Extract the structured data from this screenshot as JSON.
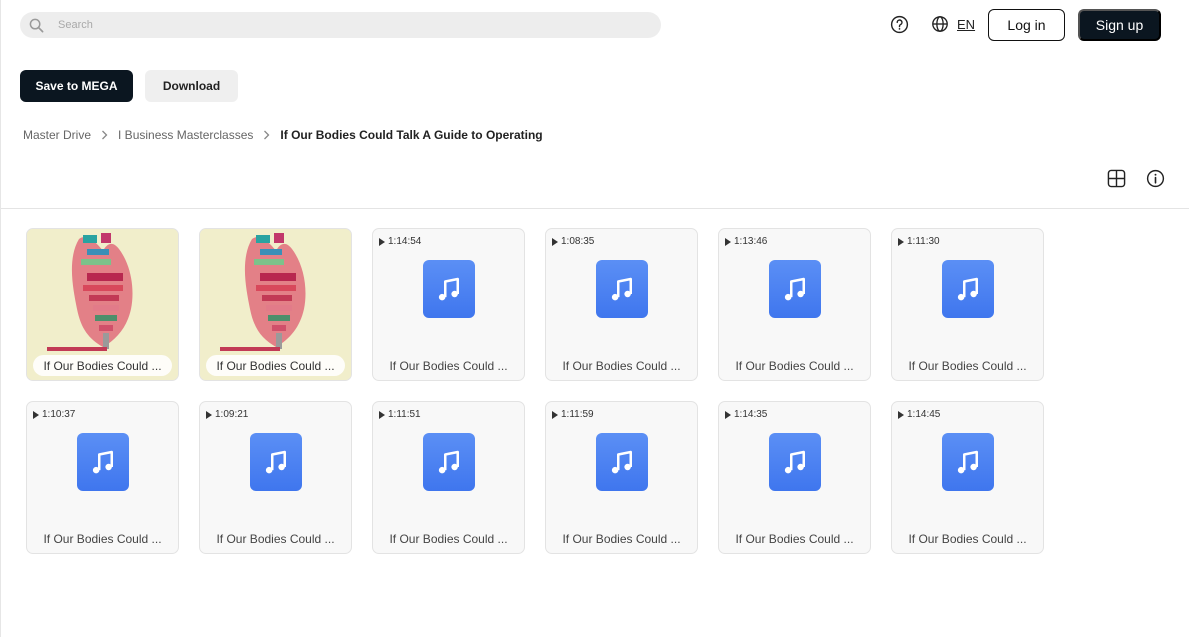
{
  "header": {
    "search_placeholder": "Search",
    "language": "EN",
    "login_label": "Log in",
    "signup_label": "Sign up"
  },
  "actions": {
    "save_label": "Save to MEGA",
    "download_label": "Download"
  },
  "breadcrumb": [
    "Master Drive",
    "I Business Masterclasses",
    "If Our Bodies Could Talk A Guide to Operating"
  ],
  "files": [
    {
      "name": "If Our Bodies Could ...",
      "type": "image",
      "duration": ""
    },
    {
      "name": "If Our Bodies Could ...",
      "type": "image",
      "duration": ""
    },
    {
      "name": "If Our Bodies Could ...",
      "type": "audio",
      "duration": "1:14:54"
    },
    {
      "name": "If Our Bodies Could ...",
      "type": "audio",
      "duration": "1:08:35"
    },
    {
      "name": "If Our Bodies Could ...",
      "type": "audio",
      "duration": "1:13:46"
    },
    {
      "name": "If Our Bodies Could ...",
      "type": "audio",
      "duration": "1:11:30"
    },
    {
      "name": "If Our Bodies Could ...",
      "type": "audio",
      "duration": "1:10:37"
    },
    {
      "name": "If Our Bodies Could ...",
      "type": "audio",
      "duration": "1:09:21"
    },
    {
      "name": "If Our Bodies Could ...",
      "type": "audio",
      "duration": "1:11:51"
    },
    {
      "name": "If Our Bodies Could ...",
      "type": "audio",
      "duration": "1:11:59"
    },
    {
      "name": "If Our Bodies Could ...",
      "type": "audio",
      "duration": "1:14:35"
    },
    {
      "name": "If Our Bodies Could ...",
      "type": "audio",
      "duration": "1:14:45"
    }
  ],
  "icons": {
    "search": "search-icon",
    "help": "help-icon",
    "globe": "globe-icon",
    "grid_view": "grid-view-icon",
    "info": "info-icon",
    "audio": "music-note-icon"
  },
  "colors": {
    "primary": "#0b1620",
    "audio_icon": "#4a82f2",
    "thumb_bg": "#f1eecb"
  }
}
